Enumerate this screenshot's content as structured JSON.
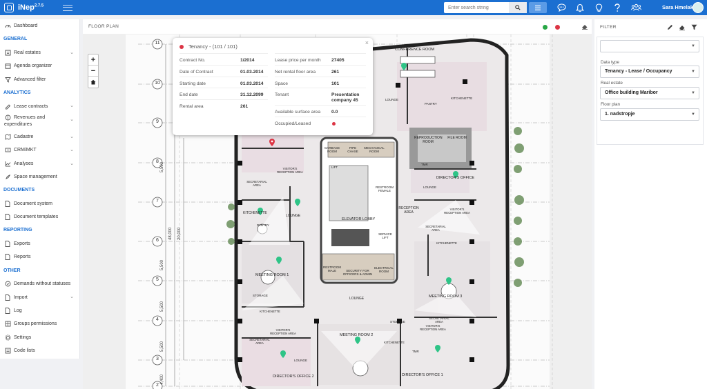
{
  "app": {
    "name": "iNep",
    "version": "2.7.5"
  },
  "header": {
    "search_placeholder": "Enter search string",
    "user_name": "Sara Hmelak"
  },
  "sidebar": {
    "dashboard": "Dashboard",
    "general": "GENERAL",
    "real_estates": "Real estates",
    "agenda_organizer": "Agenda organizer",
    "advanced_filter": "Advanced filter",
    "analytics": "ANALYTICS",
    "lease_contracts": "Lease contracts",
    "revenues_1": "Revenues and",
    "revenues_2": "expenditures",
    "cadastre": "Cadastre",
    "crm_mkt": "CRM/MKT",
    "analyses": "Analyses",
    "space_management": "Space management",
    "documents": "DOCUMENTS",
    "document_system": "Document system",
    "document_templates": "Document templates",
    "reporting": "REPORTING",
    "exports": "Exports",
    "reports": "Reports",
    "other": "OTHER",
    "demands": "Demands without statuses",
    "import": "Import",
    "log": "Log",
    "groups_permissions": "Groups permissions",
    "settings": "Settings",
    "code_lists": "Code lists"
  },
  "floor_plan": {
    "title": "FLOOR PLAN",
    "rooms": {
      "conference": "CONFERENCE ROOM",
      "pantry": "PANTRY",
      "kitchenette": "KITCHENETTE",
      "lounge": "LOUNGE",
      "reproduction": "REPRODUCTION ROOM",
      "file_room": "FILE ROOM",
      "directors_office": "DIRECTOR'S OFFICE",
      "reception": "RECEPTION AREA",
      "visitors_reception": "VISITOR'S RECEPTION AREA",
      "secretarial": "SECRETARIAL AREA",
      "elevator_lobby": "ELEVATOR LOBBY",
      "meeting_1": "MEETING ROOM 1",
      "meeting_2": "MEETING ROOM 2",
      "meeting_3": "MEETING ROOM 3",
      "directors_office_2": "DIRECTOR'S OFFICE 2",
      "directors_office_1": "DIRECTOR'S OFFICE 1",
      "storage": "STORAGE",
      "security": "SECURITY FOR OFFICERS & ADMIN",
      "electrical": "ELECTRICAL ROOM",
      "restroom_male": "RESTROOM MALE",
      "restroom_female": "RESTROOM FEMALE",
      "service_lift": "SERVICE LIFT",
      "garbage": "GARBAGE ROOM",
      "pipe": "PIPE CHASE",
      "mechanical": "MECHANICAL ROOM",
      "lift": "LIFT",
      "tmr": "TMR"
    },
    "grid_numbers": [
      "11",
      "10",
      "9",
      "8",
      "7",
      "6",
      "5",
      "4",
      "3",
      "2"
    ],
    "dimensions": [
      "5,500",
      "48,000",
      "20,000",
      "5,500",
      "5,500",
      "5,500",
      "4,400"
    ]
  },
  "popup": {
    "title": "Tenancy - (101 / 101)",
    "left": [
      {
        "k": "Contract No.",
        "v": "1/2014"
      },
      {
        "k": "Date of Contract",
        "v": "01.03.2014"
      },
      {
        "k": "Starting date",
        "v": "01.03.2014"
      },
      {
        "k": "End date",
        "v": "31.12.2099"
      },
      {
        "k": "Rental area",
        "v": "261"
      }
    ],
    "right": [
      {
        "k": "Lease price per month",
        "v": "27405"
      },
      {
        "k": "Net rental floor area",
        "v": "261"
      },
      {
        "k": "Space",
        "v": "101"
      },
      {
        "k": "Tenant",
        "v": "Presentation company 45"
      },
      {
        "k": "Available surface area",
        "v": "0.0"
      },
      {
        "k": "Occupied/Leased",
        "v": ""
      }
    ]
  },
  "filter": {
    "title": "FILTER",
    "data_type_label": "Data type",
    "data_type_value": "Tenancy - Lease / Occupancy",
    "real_estate_label": "Real estate",
    "real_estate_value": "Office building Maribor",
    "floor_plan_label": "Floor plan",
    "floor_plan_value": "1. nadstropje"
  },
  "colors": {
    "brand": "#1b6fd1",
    "occupied": "#dc3545",
    "available": "#28a745",
    "marker": "#2ec487"
  }
}
